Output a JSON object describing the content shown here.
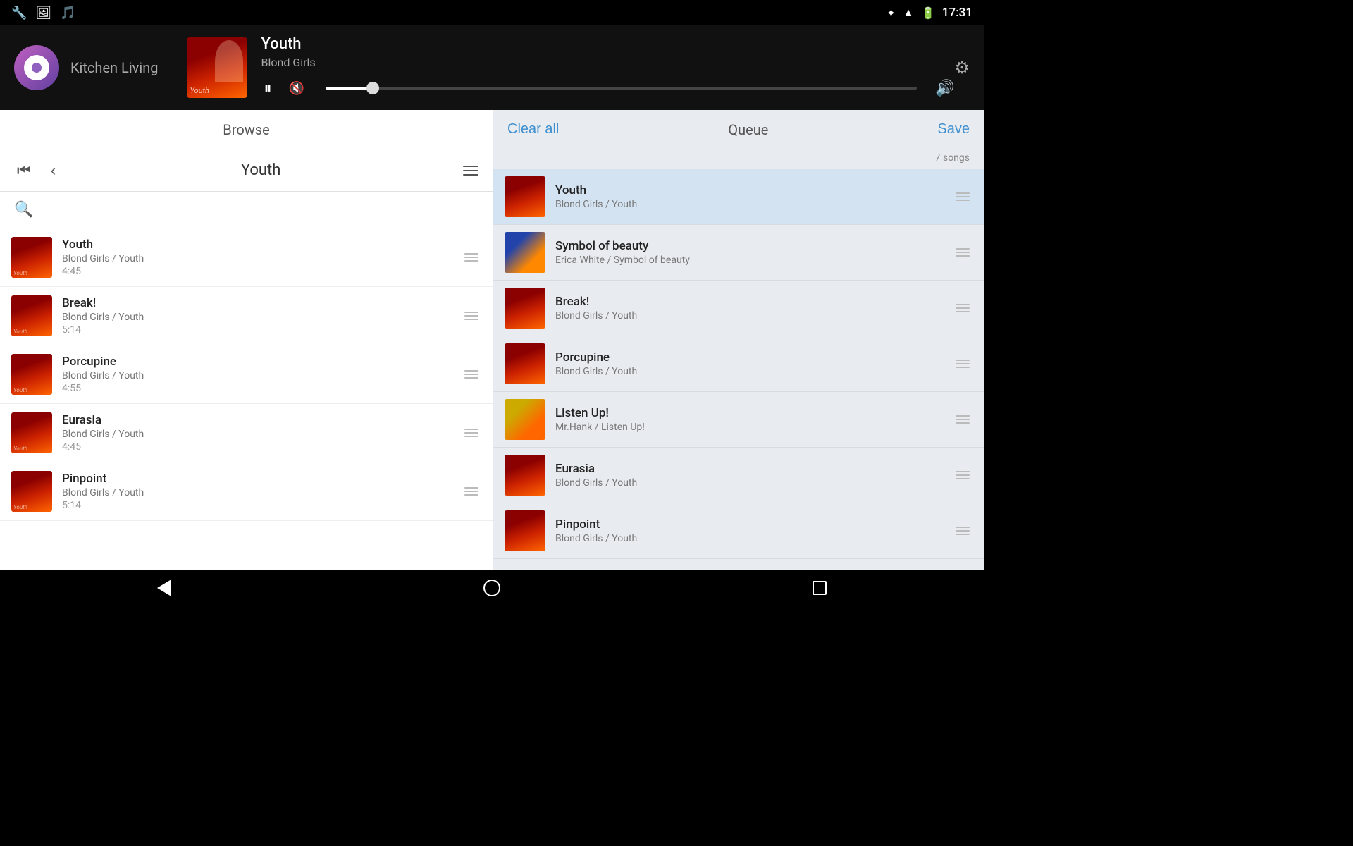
{
  "statusBar": {
    "time": "17:31",
    "icons": [
      "wrench",
      "image",
      "music-note",
      "bluetooth",
      "wifi",
      "battery"
    ]
  },
  "nowPlaying": {
    "roomLabel": "Kitchen  Living",
    "title": "Youth",
    "artist": "Blond Girls",
    "progressPercent": 8
  },
  "browse": {
    "headerTitle": "Browse",
    "navTitle": "Youth",
    "searchPlaceholder": "",
    "songs": [
      {
        "id": 1,
        "name": "Youth",
        "artist": "Blond Girls / Youth",
        "duration": "4:45"
      },
      {
        "id": 2,
        "name": "Break!",
        "artist": "Blond Girls / Youth",
        "duration": "5:14"
      },
      {
        "id": 3,
        "name": "Porcupine",
        "artist": "Blond Girls / Youth",
        "duration": "4:55"
      },
      {
        "id": 4,
        "name": "Eurasia",
        "artist": "Blond Girls / Youth",
        "duration": "4:45"
      },
      {
        "id": 5,
        "name": "Pinpoint",
        "artist": "Blond Girls / Youth",
        "duration": "5:14"
      }
    ]
  },
  "queue": {
    "headerTitle": "Queue",
    "clearAllLabel": "Clear all",
    "saveLabel": "Save",
    "songCount": "7 songs",
    "items": [
      {
        "id": 1,
        "name": "Youth",
        "sub": "Blond Girls / Youth",
        "thumbType": "youth",
        "active": true
      },
      {
        "id": 2,
        "name": "Symbol of beauty",
        "sub": "Erica White / Symbol of beauty",
        "thumbType": "symbol",
        "active": false
      },
      {
        "id": 3,
        "name": "Break!",
        "sub": "Blond Girls / Youth",
        "thumbType": "youth",
        "active": false
      },
      {
        "id": 4,
        "name": "Porcupine",
        "sub": "Blond Girls / Youth",
        "thumbType": "youth",
        "active": false
      },
      {
        "id": 5,
        "name": "Listen Up!",
        "sub": "Mr.Hank / Listen Up!",
        "thumbType": "listen",
        "active": false
      },
      {
        "id": 6,
        "name": "Eurasia",
        "sub": "Blond Girls / Youth",
        "thumbType": "youth",
        "active": false
      },
      {
        "id": 7,
        "name": "Pinpoint",
        "sub": "Blond Girls / Youth",
        "thumbType": "youth",
        "active": false
      }
    ]
  }
}
